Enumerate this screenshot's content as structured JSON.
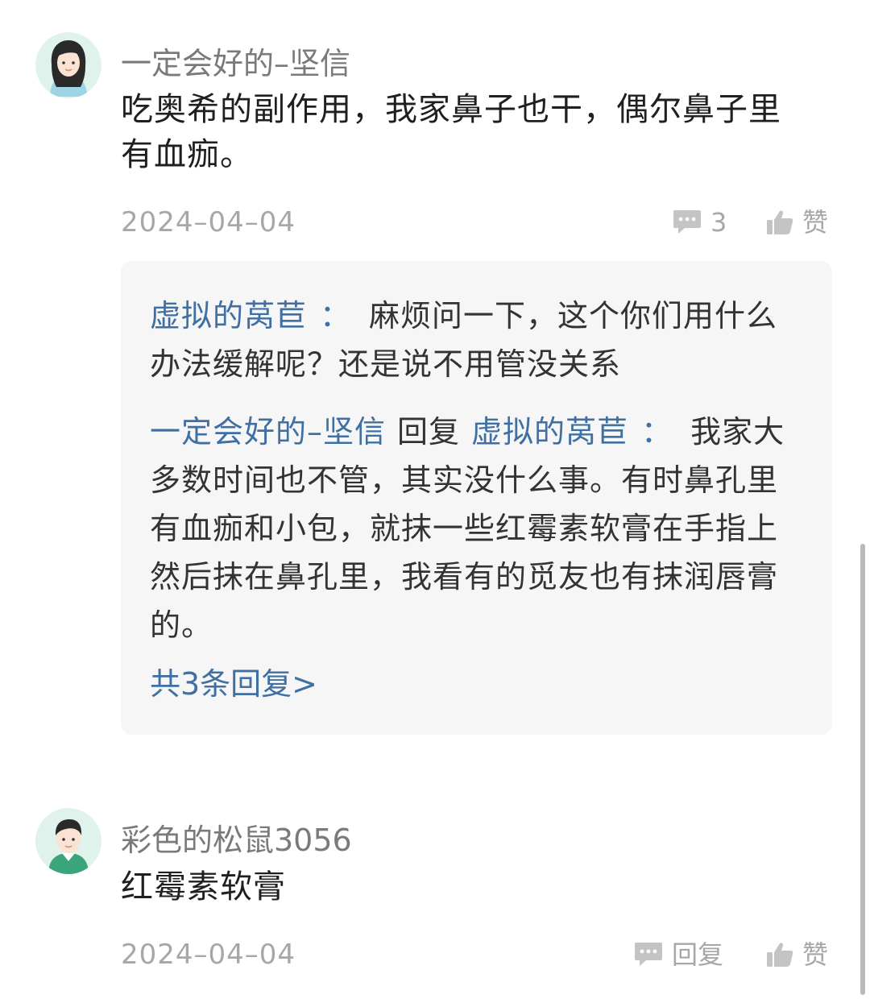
{
  "comments": [
    {
      "username": "一定会好的–坚信",
      "text": "吃奥希的副作用，我家鼻子也干，偶尔鼻子里有血痂。",
      "date": "2024–04–04",
      "reply_count": "3",
      "like_label": "赞",
      "avatar": "female-avatar-icon",
      "replies": [
        {
          "author": "虚拟的莴苣",
          "colon": "：",
          "text": "麻烦问一下，这个你们用什么办法缓解呢？还是说不用管没关系"
        },
        {
          "author": "一定会好的–坚信",
          "reply_word": "回复",
          "target": "虚拟的莴苣",
          "colon": "：",
          "text": "我家大多数时间也不管，其实没什么事。有时鼻孔里有血痂和小包，就抹一些红霉素软膏在手指上然后抹在鼻孔里，我看有的觅友也有抹润唇膏的。"
        }
      ],
      "more_replies_label": "共3条回复>"
    },
    {
      "username": "彩色的松鼠3056",
      "text": "红霉素软膏",
      "date": "2024–04–04",
      "reply_label": "回复",
      "like_label": "赞",
      "avatar": "male-avatar-icon"
    }
  ],
  "colors": {
    "link": "#3f6fa3",
    "muted": "#a7a7a7",
    "reply_bg": "#f6f6f6"
  }
}
